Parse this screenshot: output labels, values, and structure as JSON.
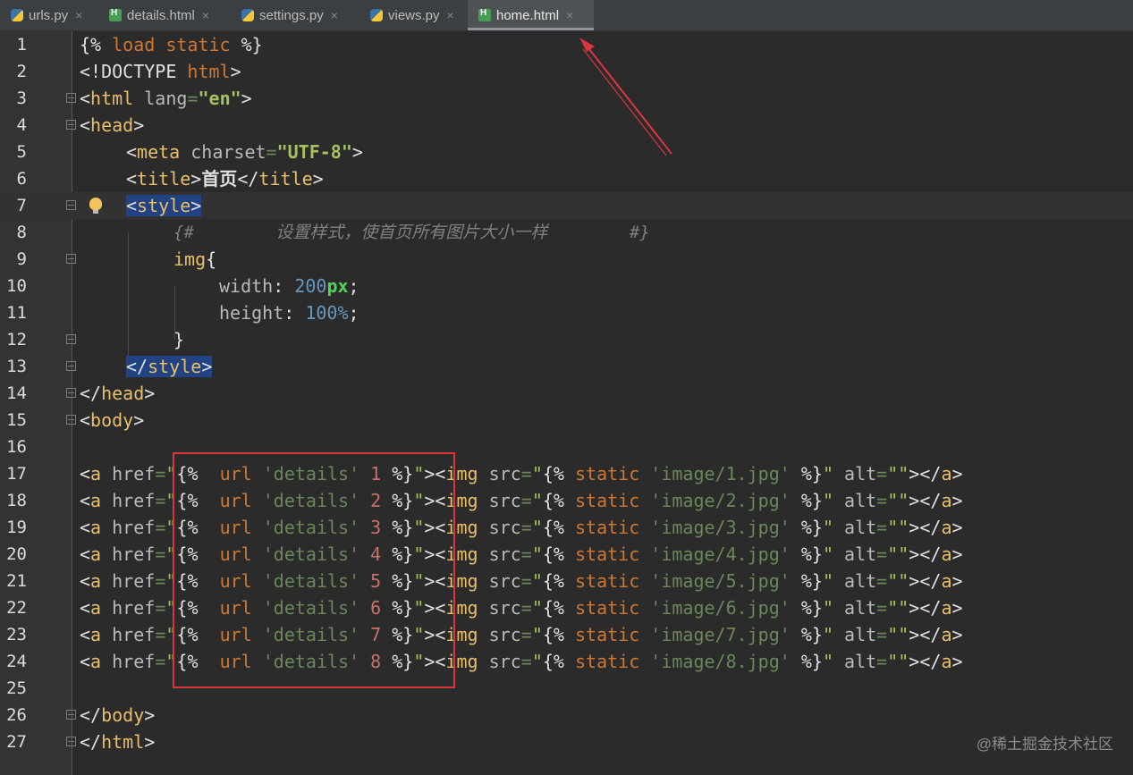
{
  "tabs": [
    {
      "label": "urls.py",
      "icon": "python-file-icon"
    },
    {
      "label": "details.html",
      "icon": "html-file-icon"
    },
    {
      "label": "settings.py",
      "icon": "python-file-icon"
    },
    {
      "label": "views.py",
      "icon": "python-file-icon"
    },
    {
      "label": "home.html",
      "icon": "html-file-icon",
      "active": true
    }
  ],
  "close_glyph": "×",
  "line_numbers": [
    "1",
    "2",
    "3",
    "4",
    "5",
    "6",
    "7",
    "8",
    "9",
    "10",
    "11",
    "12",
    "13",
    "14",
    "15",
    "16",
    "17",
    "18",
    "19",
    "20",
    "21",
    "22",
    "23",
    "24",
    "25",
    "26",
    "27"
  ],
  "code": {
    "l1": {
      "a": "{% ",
      "b": "load static",
      "c": " %}"
    },
    "l2": {
      "a": "<!DOCTYPE ",
      "b": "html",
      "c": ">"
    },
    "l3": {
      "a": "<",
      "b": "html",
      "c": " lang",
      "d": "=",
      "e": "\"en\"",
      "f": ">"
    },
    "l4": {
      "a": "<",
      "b": "head",
      "c": ">"
    },
    "l5": {
      "a": "<",
      "b": "meta",
      "c": " charset",
      "d": "=",
      "e": "\"UTF-8\"",
      "f": ">"
    },
    "l6": {
      "a": "<",
      "b": "title",
      "c": ">",
      "d": "首页",
      "e": "</",
      "f": "title",
      "g": ">"
    },
    "l7": {
      "a": "<",
      "b": "style",
      "c": ">"
    },
    "l8": {
      "a": "{#",
      "b": "        设置样式，使首页所有图片大小一样        ",
      "c": "#}"
    },
    "l9": {
      "a": "img",
      "b": "{"
    },
    "l10": {
      "a": "width",
      "b": ": ",
      "c": "200",
      "d": "px",
      "e": ";"
    },
    "l11": {
      "a": "height",
      "b": ": ",
      "c": "100%",
      "d": ";"
    },
    "l12": {
      "a": "}"
    },
    "l13": {
      "a": "</",
      "b": "style",
      "c": ">"
    },
    "l14": {
      "a": "</",
      "b": "head",
      "c": ">"
    },
    "l15": {
      "a": "<",
      "b": "body",
      "c": ">"
    },
    "l26": {
      "a": "</",
      "b": "body",
      "c": ">"
    },
    "l27": {
      "a": "</",
      "b": "html",
      "c": ">"
    }
  },
  "link_lines": [
    {
      "num": "1",
      "img": "'image/1.jpg'"
    },
    {
      "num": "2",
      "img": "'image/2.jpg'"
    },
    {
      "num": "3",
      "img": "'image/3.jpg'"
    },
    {
      "num": "4",
      "img": "'image/4.jpg'"
    },
    {
      "num": "5",
      "img": "'image/5.jpg'"
    },
    {
      "num": "6",
      "img": "'image/6.jpg'"
    },
    {
      "num": "7",
      "img": "'image/7.jpg'"
    },
    {
      "num": "8",
      "img": "'image/8.jpg'"
    }
  ],
  "link_parts": {
    "open": "<",
    "a": "a",
    "href": " href",
    "eq": "=",
    "q1": "\"",
    "tpl_open": "{%  ",
    "url": "url",
    "details": " 'details' ",
    "tpl_close": " %}",
    "q2": "\"",
    "gt": ">",
    "img_open": "<",
    "img": "img",
    "src": " src",
    "eq2": "=",
    "q3": "\"",
    "tpl_open2": "{% ",
    "static": "static",
    "tpl_close2": " %}",
    "q4": "\"",
    "alt": " alt",
    "eq3": "=",
    "empty": "\"\"",
    "gt2": ">",
    "close": "</",
    "a2": "a",
    "gt3": ">"
  },
  "watermark": "@稀土掘金技术社区",
  "colors": {
    "annotation": "#d9363e",
    "selection": "#214283"
  }
}
